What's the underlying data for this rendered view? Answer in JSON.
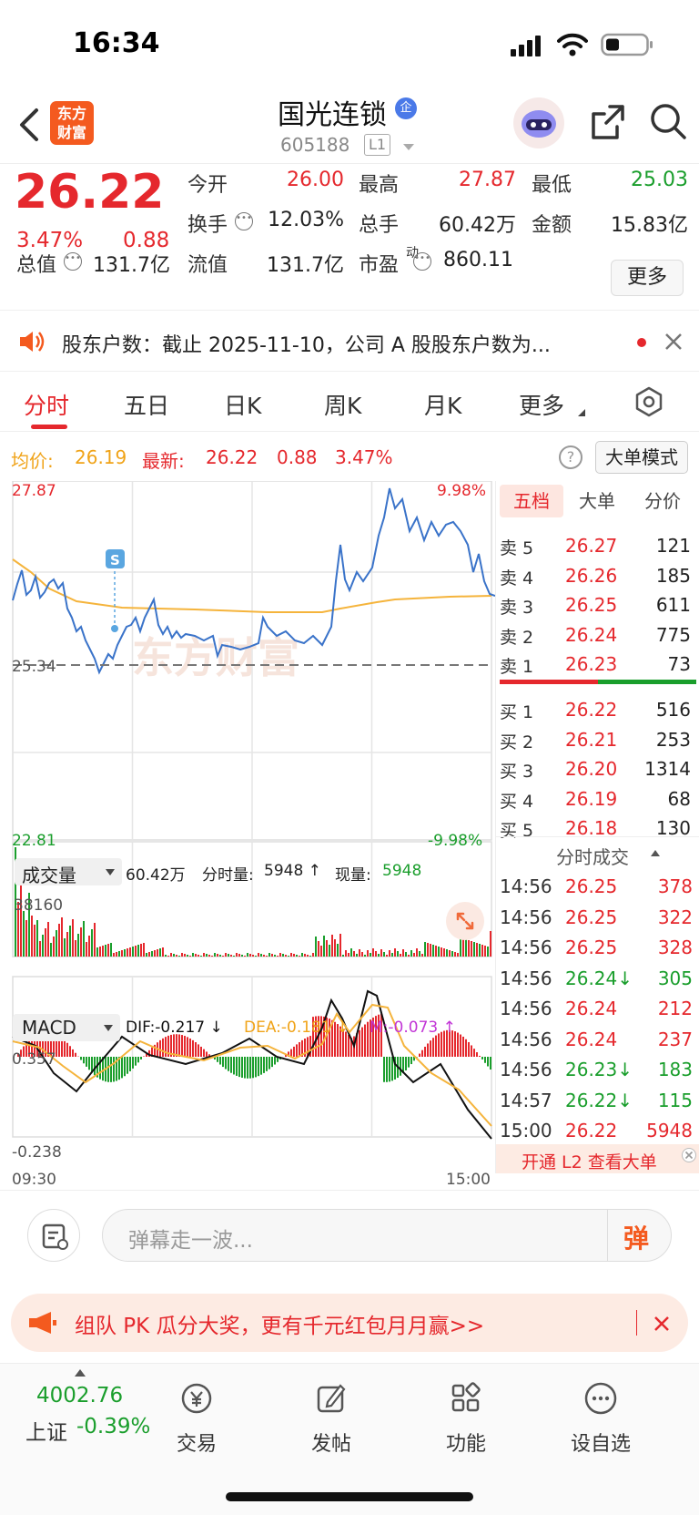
{
  "status_bar": {
    "time": "16:34"
  },
  "header": {
    "logo_line1": "东方",
    "logo_line2": "财富",
    "title": "国光连锁",
    "badge": "企",
    "code": "605188",
    "level": "L1"
  },
  "quote": {
    "price": "26.22",
    "change_pct": "3.47%",
    "change": "0.88",
    "fields": [
      {
        "label": "今开",
        "value": "26.00",
        "color": "red"
      },
      {
        "label": "最高",
        "value": "27.87",
        "color": "red"
      },
      {
        "label": "最低",
        "value": "25.03",
        "color": "green"
      },
      {
        "label": "换手",
        "value": "12.03%",
        "color": "dark"
      },
      {
        "label": "总手",
        "value": "60.42万",
        "color": "dark"
      },
      {
        "label": "金额",
        "value": "15.83亿",
        "color": "dark"
      },
      {
        "label": "总值",
        "value": "131.7亿",
        "color": "dark"
      },
      {
        "label": "流值",
        "value": "131.7亿",
        "color": "dark"
      },
      {
        "label": "市盈",
        "sup": "动",
        "value": "860.11",
        "color": "dark"
      }
    ],
    "more_label": "更多"
  },
  "notice": {
    "text": "股东户数：截止 2025-11-10，公司 A 股股东户数为..."
  },
  "tabs": [
    "分时",
    "五日",
    "日K",
    "周K",
    "月K",
    "更多"
  ],
  "info_row": {
    "avg_label": "均价:",
    "avg": "26.19",
    "last_label": "最新:",
    "last": "26.22",
    "chg": "0.88",
    "pct": "3.47%",
    "mode_label": "大单模式"
  },
  "chart_labels": {
    "max": "27.87",
    "max_pct": "9.98%",
    "ref": "25.34",
    "min": "22.81",
    "min_pct": "-9.98%",
    "s_marker": "S",
    "watermark": "东方财富",
    "time_start": "09:30",
    "time_end": "15:00"
  },
  "volume_row": {
    "selector": "成交量",
    "total": "60.42万",
    "period_label": "分时量:",
    "period": "5948 ↑",
    "now_label": "现量:",
    "now": "5948",
    "peak": "38160"
  },
  "macd_row": {
    "selector": "MACD",
    "dif": "DIF:-0.217 ↓",
    "dea": "DEA:-0.181 ↓",
    "m": "M:-0.073 ↑",
    "top": "0.357",
    "bottom": "-0.238"
  },
  "order_book": {
    "tabs": [
      "五档",
      "大单",
      "分价"
    ],
    "asks": [
      {
        "label": "卖 5",
        "price": "26.27",
        "vol": "121"
      },
      {
        "label": "卖 4",
        "price": "26.26",
        "vol": "185"
      },
      {
        "label": "卖 3",
        "price": "26.25",
        "vol": "611"
      },
      {
        "label": "卖 2",
        "price": "26.24",
        "vol": "775"
      },
      {
        "label": "卖 1",
        "price": "26.23",
        "vol": "73"
      }
    ],
    "bids": [
      {
        "label": "买 1",
        "price": "26.22",
        "vol": "516"
      },
      {
        "label": "买 2",
        "price": "26.21",
        "vol": "253"
      },
      {
        "label": "买 3",
        "price": "26.20",
        "vol": "1314"
      },
      {
        "label": "买 4",
        "price": "26.19",
        "vol": "68"
      },
      {
        "label": "买 5",
        "price": "26.18",
        "vol": "130"
      }
    ]
  },
  "trades": {
    "title": "分时成交",
    "rows": [
      {
        "time": "14:56",
        "price": "26.25",
        "vol": "378",
        "c": "red"
      },
      {
        "time": "14:56",
        "price": "26.25",
        "vol": "322",
        "c": "red"
      },
      {
        "time": "14:56",
        "price": "26.25",
        "vol": "328",
        "c": "red"
      },
      {
        "time": "14:56",
        "price": "26.24↓",
        "vol": "305",
        "c": "green"
      },
      {
        "time": "14:56",
        "price": "26.24",
        "vol": "212",
        "c": "red"
      },
      {
        "time": "14:56",
        "price": "26.24",
        "vol": "237",
        "c": "red"
      },
      {
        "time": "14:56",
        "price": "26.23↓",
        "vol": "183",
        "c": "green"
      },
      {
        "time": "14:57",
        "price": "26.22↓",
        "vol": "115",
        "c": "green"
      },
      {
        "time": "15:00",
        "price": "26.22",
        "vol": "5948",
        "c": "red"
      }
    ],
    "l2_banner": "开通 L2 查看大单"
  },
  "comment": {
    "placeholder": "弹幕走一波...",
    "danmu": "弹"
  },
  "promo": {
    "text": "组队 PK 瓜分大奖，更有千元红包月月赢>>"
  },
  "bottom_nav": {
    "index_value": "4002.76",
    "index_name": "上证",
    "index_pct": "-0.39%",
    "items": [
      "交易",
      "发帖",
      "功能",
      "设自选"
    ]
  }
}
